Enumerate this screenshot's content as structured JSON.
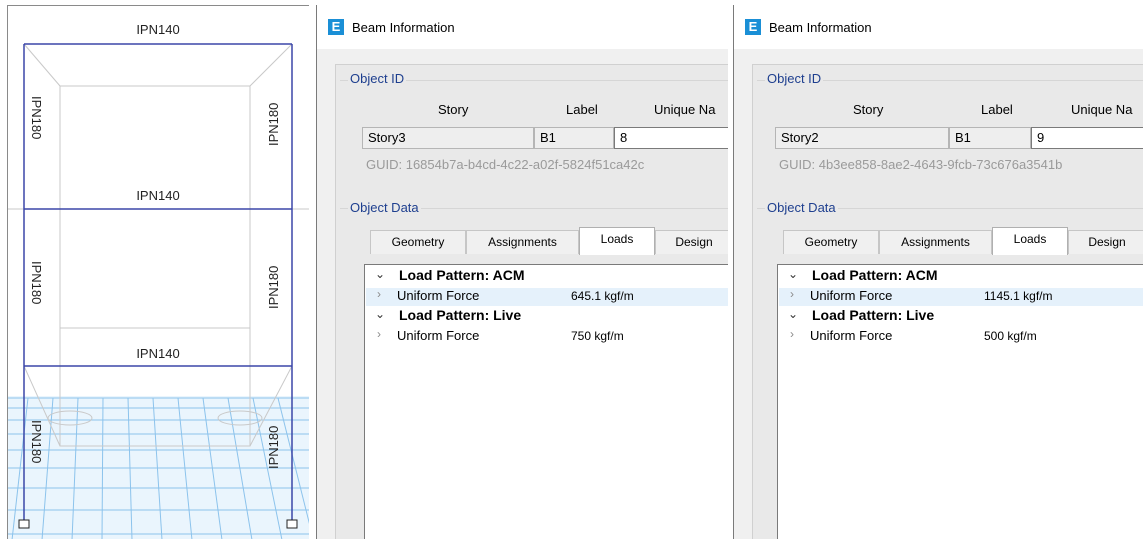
{
  "model_view": {
    "labels": {
      "beam_top": "IPN140",
      "beam_mid": "IPN140",
      "beam_low": "IPN140",
      "col_top_left": "IPN180",
      "col_top_right": "IPN180",
      "col_mid_left": "IPN180",
      "col_mid_right": "IPN180",
      "col_low_left": "IPN180",
      "col_low_right": "IPN180"
    },
    "colors": {
      "frame": "#3b47a8",
      "floor_grid": "#6fb3e6",
      "guide": "#c8c8c8"
    }
  },
  "windows": [
    {
      "title": "Beam Information",
      "app_icon": "E",
      "object_id": {
        "group_title": "Object ID",
        "col_story": "Story",
        "col_label": "Label",
        "col_unique": "Unique Na",
        "story": "Story3",
        "label": "B1",
        "unique_name": "8",
        "guid": "GUID:  16854b7a-b4cd-4c22-a02f-5824f51ca42c"
      },
      "object_data": {
        "group_title": "Object Data",
        "tabs": [
          "Geometry",
          "Assignments",
          "Loads",
          "Design"
        ],
        "active_tab": "Loads",
        "patterns": [
          {
            "title": "Load Pattern: ACM",
            "prop_name": "Uniform Force",
            "prop_value": "645.1 kgf/m"
          },
          {
            "title": "Load Pattern: Live",
            "prop_name": "Uniform Force",
            "prop_value": "750 kgf/m"
          }
        ]
      }
    },
    {
      "title": "Beam Information",
      "app_icon": "E",
      "object_id": {
        "group_title": "Object ID",
        "col_story": "Story",
        "col_label": "Label",
        "col_unique": "Unique Na",
        "story": "Story2",
        "label": "B1",
        "unique_name": "9",
        "guid": "GUID:  4b3ee858-8ae2-4643-9fcb-73c676a3541b"
      },
      "object_data": {
        "group_title": "Object Data",
        "tabs": [
          "Geometry",
          "Assignments",
          "Loads",
          "Design"
        ],
        "active_tab": "Loads",
        "patterns": [
          {
            "title": "Load Pattern: ACM",
            "prop_name": "Uniform Force",
            "prop_value": "1145.1 kgf/m"
          },
          {
            "title": "Load Pattern: Live",
            "prop_name": "Uniform Force",
            "prop_value": "500 kgf/m"
          }
        ]
      }
    }
  ]
}
